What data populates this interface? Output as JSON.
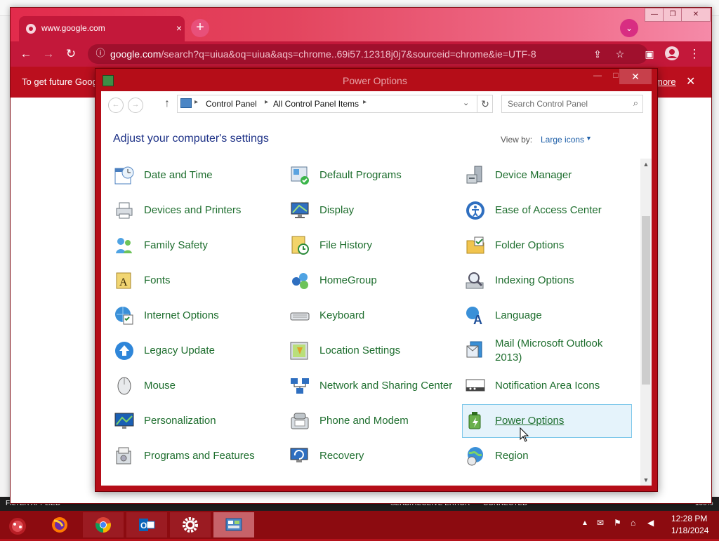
{
  "browser": {
    "tab_title": "www.google.com",
    "tab_close": "×",
    "new_tab": "+",
    "tab_search": "⌄",
    "url_host": "google.com",
    "url_rest": "/search?q=uiua&oq=uiua&aqs=chrome..69i57.12318j0j7&sourceid=chrome&ie=UTF-8",
    "info_text_left": "To get future Goog",
    "info_text_right": "more",
    "window_min": "—",
    "window_max": "❐",
    "window_close": "✕"
  },
  "control_panel": {
    "window_title": "Power Options",
    "close_glyph": "✕",
    "breadcrumb": [
      "Control Panel",
      "All Control Panel Items"
    ],
    "search_placeholder": "Search Control Panel",
    "heading": "Adjust your computer's settings",
    "view_by_label": "View by:",
    "view_by_value": "Large icons",
    "items": [
      {
        "label": "Date and Time",
        "icon": "calendar-clock-icon"
      },
      {
        "label": "Default Programs",
        "icon": "default-programs-icon"
      },
      {
        "label": "Device Manager",
        "icon": "device-manager-icon"
      },
      {
        "label": "Devices and Printers",
        "icon": "printer-icon"
      },
      {
        "label": "Display",
        "icon": "monitor-icon"
      },
      {
        "label": "Ease of Access Center",
        "icon": "ease-of-access-icon"
      },
      {
        "label": "Family Safety",
        "icon": "family-safety-icon"
      },
      {
        "label": "File History",
        "icon": "file-history-icon"
      },
      {
        "label": "Folder Options",
        "icon": "folder-options-icon"
      },
      {
        "label": "Fonts",
        "icon": "fonts-icon"
      },
      {
        "label": "HomeGroup",
        "icon": "homegroup-icon"
      },
      {
        "label": "Indexing Options",
        "icon": "indexing-icon"
      },
      {
        "label": "Internet Options",
        "icon": "internet-options-icon"
      },
      {
        "label": "Keyboard",
        "icon": "keyboard-icon"
      },
      {
        "label": "Language",
        "icon": "language-icon"
      },
      {
        "label": "Legacy Update",
        "icon": "legacy-update-icon"
      },
      {
        "label": "Location Settings",
        "icon": "location-icon"
      },
      {
        "label": "Mail (Microsoft Outlook 2013)",
        "icon": "mail-icon"
      },
      {
        "label": "Mouse",
        "icon": "mouse-icon"
      },
      {
        "label": "Network and Sharing Center",
        "icon": "network-icon"
      },
      {
        "label": "Notification Area Icons",
        "icon": "notification-area-icon"
      },
      {
        "label": "Personalization",
        "icon": "personalization-icon"
      },
      {
        "label": "Phone and Modem",
        "icon": "phone-modem-icon"
      },
      {
        "label": "Power Options",
        "icon": "power-options-icon"
      },
      {
        "label": "Programs and Features",
        "icon": "programs-features-icon"
      },
      {
        "label": "Recovery",
        "icon": "recovery-icon"
      },
      {
        "label": "Region",
        "icon": "region-icon"
      }
    ],
    "hovered_item": "Power Options"
  },
  "outlook_status": {
    "left": "FILTER APPLIED",
    "middle": "SEND/RECEIVE ERROR",
    "connected": "CONNECTED",
    "zoom": "100%"
  },
  "taskbar": {
    "apps": [
      {
        "name": "firefox",
        "icon": "firefox-icon"
      },
      {
        "name": "chrome",
        "icon": "chrome-icon"
      },
      {
        "name": "outlook",
        "icon": "outlook-icon"
      },
      {
        "name": "settings",
        "icon": "settings-gear-icon"
      },
      {
        "name": "control-panel",
        "icon": "control-panel-icon"
      }
    ],
    "time": "12:28 PM",
    "date": "1/18/2024"
  },
  "colors": {
    "accent_red": "#c3183a",
    "link_green": "#1e6e2e",
    "heading_blue": "#1e3287",
    "hover_bg": "#e5f3fb"
  }
}
